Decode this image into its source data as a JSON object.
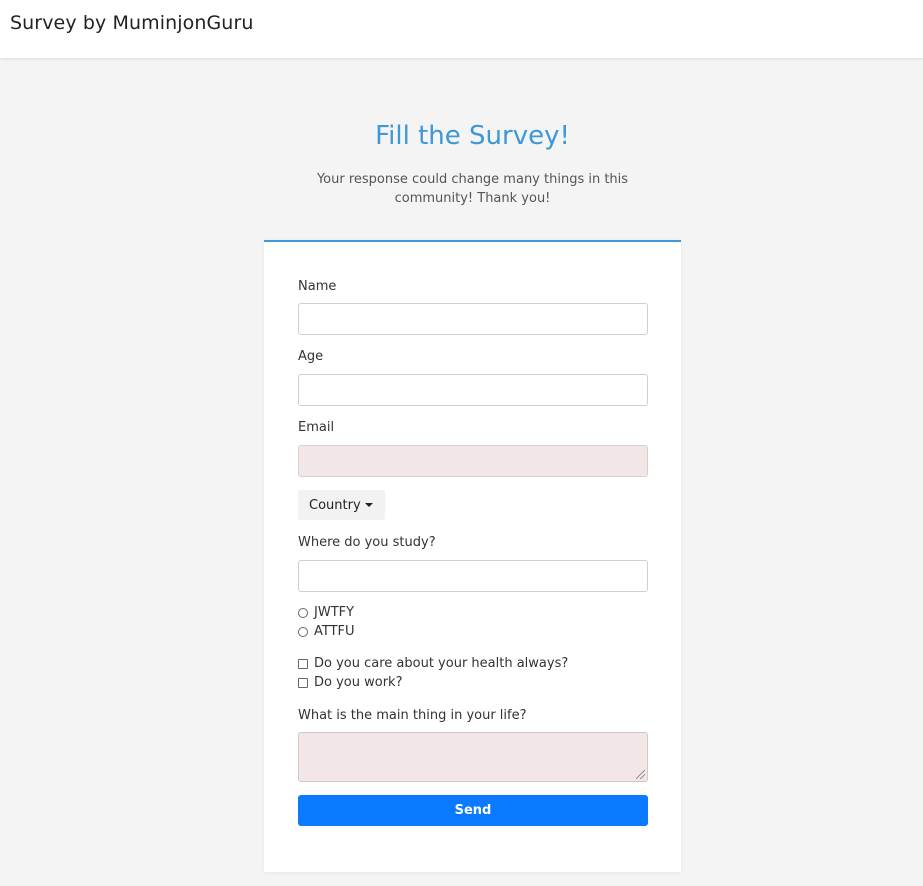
{
  "navbar": {
    "brand": "Survey by MuminjonGuru"
  },
  "hero": {
    "title": "Fill the Survey!",
    "subtitle": "Your response could change many things in this community! Thank you!"
  },
  "form": {
    "name_label": "Name",
    "name_value": "",
    "age_label": "Age",
    "age_value": "",
    "email_label": "Email",
    "email_value": "",
    "country_button": "Country",
    "study_label": "Where do you study?",
    "study_value": "",
    "radios": [
      {
        "label": "JWTFY",
        "checked": false
      },
      {
        "label": "ATTFU",
        "checked": false
      }
    ],
    "checkboxes": [
      {
        "label": "Do you care about your health always?",
        "checked": false
      },
      {
        "label": "Do you work?",
        "checked": false
      }
    ],
    "main_thing_label": "What is the main thing in your life?",
    "main_thing_value": "",
    "send_label": "Send"
  },
  "colors": {
    "accent": "#3e97d8",
    "button": "#0a7bff",
    "field_tint": "#f3e6e6",
    "background": "#f4f4f4"
  }
}
